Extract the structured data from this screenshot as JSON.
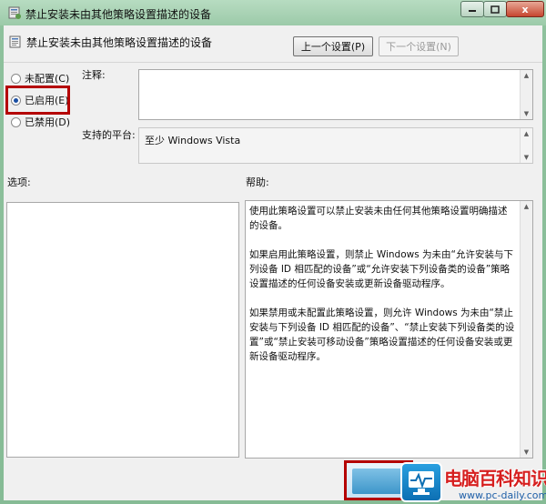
{
  "window": {
    "title": "禁止安装未由其他策略设置描述的设备",
    "minimize_icon": "minimize-icon",
    "maximize_icon": "maximize-icon",
    "close_label": "x"
  },
  "header": {
    "policy_title": "禁止安装未由其他策略设置描述的设备",
    "prev_label": "上一个设置(P)",
    "next_label": "下一个设置(N)"
  },
  "state": {
    "options": [
      {
        "label": "未配置(C)",
        "selected": false
      },
      {
        "label": "已启用(E)",
        "selected": true
      },
      {
        "label": "已禁用(D)",
        "selected": false
      }
    ]
  },
  "labels": {
    "comment": "注释:",
    "platform": "支持的平台:",
    "options": "选项:",
    "help": "帮助:"
  },
  "platform_value": "至少 Windows Vista",
  "help": {
    "paragraphs": [
      "使用此策略设置可以禁止安装未由任何其他策略设置明确描述的设备。",
      "如果启用此策略设置，则禁止 Windows 为未由“允许安装与下列设备 ID 相匹配的设备”或“允许安装下列设备类的设备”策略设置描述的任何设备安装或更新设备驱动程序。",
      "如果禁用或未配置此策略设置，则允许 Windows 为未由“禁止安装与下列设备 ID 相匹配的设备”、“禁止安装下列设备类的设置”或“禁止安装可移动设备”策略设置描述的任何设备安装或更新设备驱动程序。"
    ]
  },
  "watermark": {
    "title": "电脑百科知识",
    "url": "www.pc-daily.com"
  },
  "colors": {
    "highlight": "#b40000",
    "frame": "#8ec19d",
    "accent": "#1a4fa3"
  }
}
